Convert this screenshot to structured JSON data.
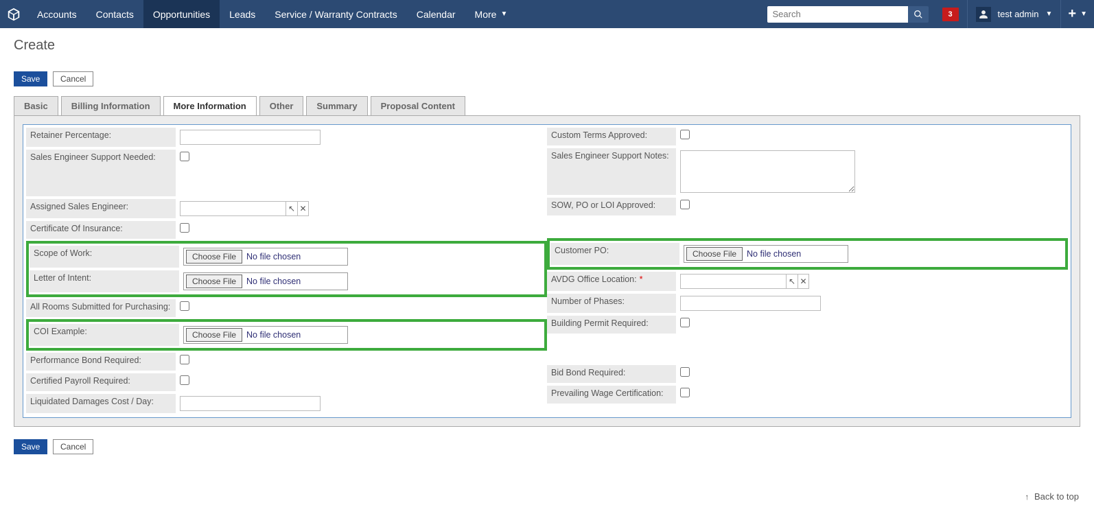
{
  "nav": {
    "items": [
      "Accounts",
      "Contacts",
      "Opportunities",
      "Leads",
      "Service / Warranty Contracts",
      "Calendar",
      "More"
    ],
    "activeIndex": 2,
    "searchPlaceholder": "Search",
    "notifCount": "3",
    "userName": "test admin"
  },
  "page": {
    "title": "Create",
    "saveLabel": "Save",
    "cancelLabel": "Cancel",
    "backToTop": "Back to top"
  },
  "tabs": {
    "items": [
      "Basic",
      "Billing Information",
      "More Information",
      "Other",
      "Summary",
      "Proposal Content"
    ],
    "activeIndex": 2
  },
  "form": {
    "left": {
      "retainerPct": "Retainer Percentage:",
      "salesEngSupportNeeded": "Sales Engineer Support Needed:",
      "assignedSalesEng": "Assigned Sales Engineer:",
      "certOfIns": "Certificate Of Insurance:",
      "scopeOfWork": "Scope of Work:",
      "letterOfIntent": "Letter of Intent:",
      "allRooms": "All Rooms Submitted for Purchasing:",
      "coiExample": "COI Example:",
      "perfBond": "Performance Bond Required:",
      "certPayroll": "Certified Payroll Required:",
      "liqDamages": "Liquidated Damages Cost / Day:"
    },
    "right": {
      "customTerms": "Custom Terms Approved:",
      "salesEngNotes": "Sales Engineer Support Notes:",
      "sowPoLoi": "SOW, PO or LOI Approved:",
      "customerPO": "Customer PO:",
      "avdgOffice": "AVDG Office Location:",
      "numPhases": "Number of Phases:",
      "buildPermit": "Building Permit Required:",
      "bidBond": "Bid Bond Required:",
      "prevWage": "Prevailing Wage Certification:"
    },
    "file": {
      "chooseLabel": "Choose File",
      "noFile": "No file chosen"
    }
  }
}
